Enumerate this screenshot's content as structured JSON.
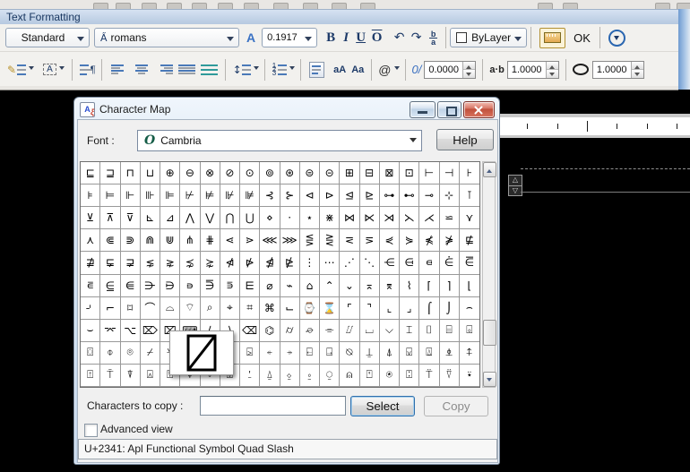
{
  "text_formatting": {
    "caption": "Text Formatting",
    "style_value": "Standard",
    "font_value": "romans",
    "annotative_icon": "A",
    "height_value": "0.1917",
    "bold_label": "B",
    "italic_label": "I",
    "underline_label": "U",
    "overline_label": "O",
    "undo_icon": "↶",
    "redo_icon": "↷",
    "stack_top": "b",
    "stack_bottom": "a",
    "color_value": "ByLayer",
    "ok_label": "OK",
    "justification_icon": "A",
    "paragraph_icon": "¶",
    "linespacing_icon": "↕",
    "uppercase_label": "aA",
    "lowercase_label": "Aa",
    "symbol_label": "@",
    "oblique_icon": "0/",
    "oblique_value": "0.0000",
    "tracking_icon": "a·b",
    "tracking_value": "1.0000",
    "width_value": "1.0000"
  },
  "charmap": {
    "title": "Character Map",
    "font_label": "Font :",
    "font_value": "Cambria",
    "opentype_icon": "O",
    "help_label": "Help",
    "copy_label": "Characters to copy :",
    "copy_value": "",
    "select_label": "Select",
    "copy_button_label": "Copy",
    "advanced_label": "Advanced view",
    "status_text": "U+2341: Apl Functional Symbol Quad Slash",
    "selected_char": "⍁",
    "selected_codepoint": "U+2341",
    "grid": {
      "selected_cell": {
        "row": 8,
        "col": 5
      },
      "rows": [
        "⊑⊒⊓⊔⊕⊖⊗⊘⊙⊚⊛⊜⊝⊞⊟⊠⊡⊢⊣⊦",
        "⊧⊨⊩⊪⊫⊬⊭⊮⊯⊰⊱⊲⊳⊴⊵⊶⊷⊸⊹⊺",
        "⊻⊼⊽⊾⊿⋀⋁⋂⋃⋄⋅⋆⋇⋈⋉⋊⋋⋌⋍⋎",
        "⋏⋐⋑⋒⋓⋔⋕⋖⋗⋘⋙⋚⋛⋜⋝⋞⋟⋠⋡⋢",
        "⋣⋤⋥⋦⋧⋨⋩⋪⋫⋬⋭⋮⋯⋰⋱⋲⋳⋴⋵⋶",
        "⋷⋸⋹⋺⋻⋼⋽⋾⋿⌀⌁⌂⌃⌄⌅⌆⌇⌈⌉⌊",
        "⌏⌐⌑⌒⌓⌔⌕⌖⌗⌘⌙⌚⌛⌜⌝⌞⌟⌠⌡⌢",
        "⌣⌤⌥⌦⌧⌨⟨⟩⌫⌬⌭⌮⌯⌰⌴⌵⌶⌷⌸⌻",
        "⌼⌽⌾⌿⍀⍁⍂⍃⍄⍅⍆⍇⍈⍉⍊⍋⍌⍍⍎⍏",
        "⍐⍑⍒⍓⍔⍕⍖⍗⍘⍙⍚⍛⍜⍝⍞⍟⍠⍡⍢⍣"
      ]
    }
  },
  "colors": {
    "caption_blue": "#c3d5ea",
    "toolbar_caption_blue": "#c0d2e8",
    "close_button_red": "#c04f3b",
    "select_focus_blue": "#2f6fac",
    "ruler_toggle_gold": "#b29133",
    "drawing_background": "#000000"
  }
}
